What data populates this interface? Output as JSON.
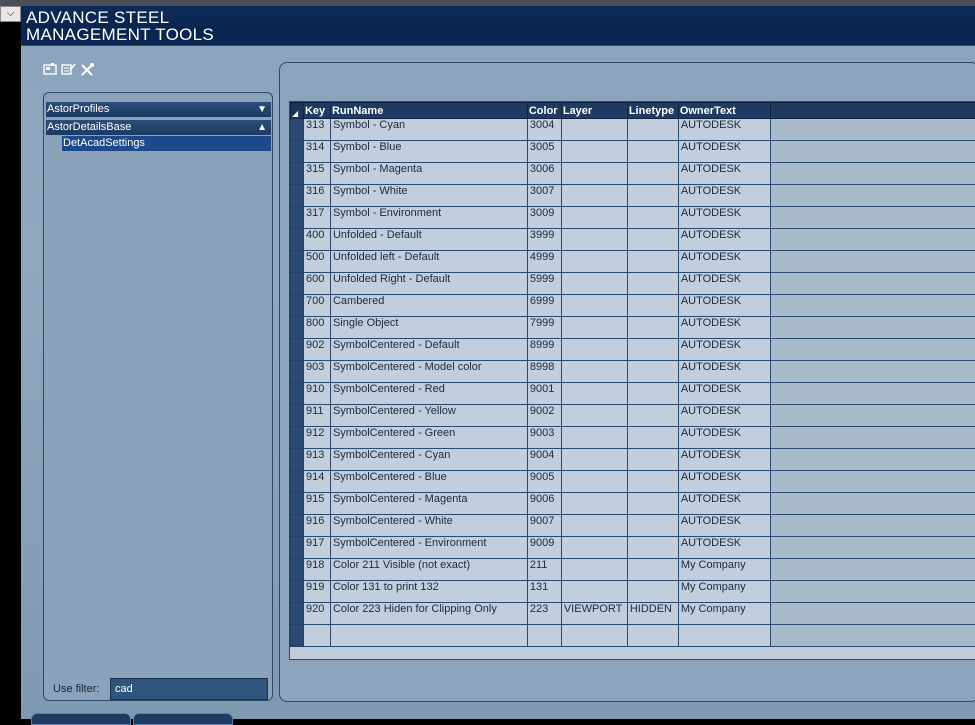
{
  "app": {
    "title_line1": "ADVANCE STEEL",
    "title_line2": "MANAGEMENT TOOLS"
  },
  "toolbar": {
    "icons": [
      "db-icon",
      "edit-icon",
      "tools-icon"
    ]
  },
  "tree": {
    "groups": [
      {
        "label": "AstorProfiles",
        "arrow": "▼"
      },
      {
        "label": "AstorDetailsBase",
        "arrow": "▲"
      }
    ],
    "selected_item": "DetAcadSettings"
  },
  "filter": {
    "label": "Use filter:",
    "value": "cad"
  },
  "grid": {
    "columns": [
      "Key",
      "RunName",
      "Color",
      "Layer",
      "Linetype",
      "OwnerText"
    ],
    "rows": [
      {
        "key": "313",
        "runname": "Symbol - Cyan",
        "color": "3004",
        "layer": "",
        "linetype": "",
        "owner": "AUTODESK"
      },
      {
        "key": "314",
        "runname": "Symbol - Blue",
        "color": "3005",
        "layer": "",
        "linetype": "",
        "owner": "AUTODESK"
      },
      {
        "key": "315",
        "runname": "Symbol - Magenta",
        "color": "3006",
        "layer": "",
        "linetype": "",
        "owner": "AUTODESK"
      },
      {
        "key": "316",
        "runname": "Symbol - White",
        "color": "3007",
        "layer": "",
        "linetype": "",
        "owner": "AUTODESK"
      },
      {
        "key": "317",
        "runname": "Symbol - Environment",
        "color": "3009",
        "layer": "",
        "linetype": "",
        "owner": "AUTODESK"
      },
      {
        "key": "400",
        "runname": "Unfolded - Default",
        "color": "3999",
        "layer": "",
        "linetype": "",
        "owner": "AUTODESK"
      },
      {
        "key": "500",
        "runname": "Unfolded left - Default",
        "color": "4999",
        "layer": "",
        "linetype": "",
        "owner": "AUTODESK"
      },
      {
        "key": "600",
        "runname": "Unfolded Right - Default",
        "color": "5999",
        "layer": "",
        "linetype": "",
        "owner": "AUTODESK"
      },
      {
        "key": "700",
        "runname": "Cambered",
        "color": "6999",
        "layer": "",
        "linetype": "",
        "owner": "AUTODESK"
      },
      {
        "key": "800",
        "runname": "Single Object",
        "color": "7999",
        "layer": "",
        "linetype": "",
        "owner": "AUTODESK"
      },
      {
        "key": "902",
        "runname": "SymbolCentered - Default",
        "color": "8999",
        "layer": "",
        "linetype": "",
        "owner": "AUTODESK"
      },
      {
        "key": "903",
        "runname": "SymbolCentered - Model color",
        "color": "8998",
        "layer": "",
        "linetype": "",
        "owner": "AUTODESK"
      },
      {
        "key": "910",
        "runname": "SymbolCentered - Red",
        "color": "9001",
        "layer": "",
        "linetype": "",
        "owner": "AUTODESK"
      },
      {
        "key": "911",
        "runname": "SymbolCentered - Yellow",
        "color": "9002",
        "layer": "",
        "linetype": "",
        "owner": "AUTODESK"
      },
      {
        "key": "912",
        "runname": "SymbolCentered - Green",
        "color": "9003",
        "layer": "",
        "linetype": "",
        "owner": "AUTODESK"
      },
      {
        "key": "913",
        "runname": "SymbolCentered - Cyan",
        "color": "9004",
        "layer": "",
        "linetype": "",
        "owner": "AUTODESK"
      },
      {
        "key": "914",
        "runname": "SymbolCentered - Blue",
        "color": "9005",
        "layer": "",
        "linetype": "",
        "owner": "AUTODESK"
      },
      {
        "key": "915",
        "runname": "SymbolCentered - Magenta",
        "color": "9006",
        "layer": "",
        "linetype": "",
        "owner": "AUTODESK"
      },
      {
        "key": "916",
        "runname": "SymbolCentered - White",
        "color": "9007",
        "layer": "",
        "linetype": "",
        "owner": "AUTODESK"
      },
      {
        "key": "917",
        "runname": "SymbolCentered - Environment",
        "color": "9009",
        "layer": "",
        "linetype": "",
        "owner": "AUTODESK"
      },
      {
        "key": "918",
        "runname": "Color 211 Visible (not exact)",
        "color": "211",
        "layer": "",
        "linetype": "",
        "owner": "My Company"
      },
      {
        "key": "919",
        "runname": "Color 131 to print 132",
        "color": "131",
        "layer": "",
        "linetype": "",
        "owner": "My Company"
      },
      {
        "key": "920",
        "runname": "Color 223 Hiden for Clipping Only",
        "color": "223",
        "layer": "VIEWPORT",
        "linetype": "HIDDEN",
        "owner": "My Company"
      }
    ]
  }
}
